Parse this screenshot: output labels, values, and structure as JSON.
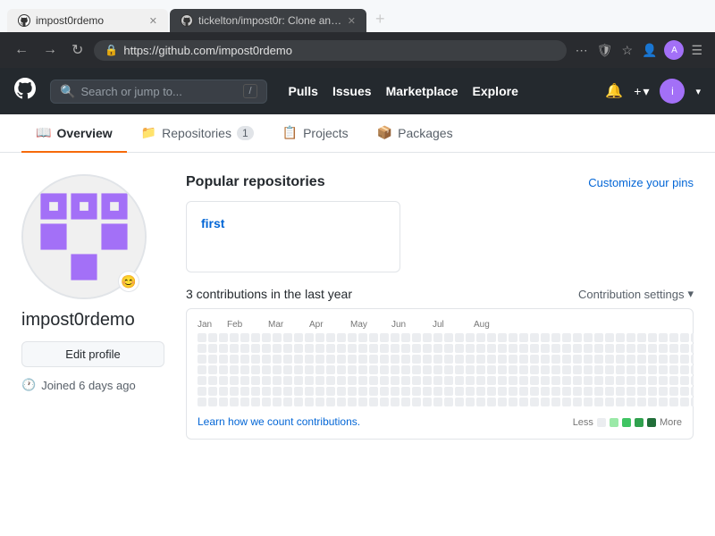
{
  "browser": {
    "tabs": [
      {
        "id": "tab1",
        "label": "impost0rdemo",
        "url": "https://github.com/impost0rdemo",
        "active": true,
        "favicon": "github"
      },
      {
        "id": "tab2",
        "label": "tickelton/impost0r: Clone anot…",
        "url": "",
        "active": false,
        "favicon": "github"
      }
    ],
    "address": "https://github.com/impost0rdemo",
    "new_tab_title": "+"
  },
  "nav": {
    "search_placeholder": "Search or jump to...",
    "slash_key": "/",
    "links": [
      "Pulls",
      "Issues",
      "Marketplace",
      "Explore"
    ],
    "logo_aria": "GitHub"
  },
  "profile_tabs": [
    {
      "id": "overview",
      "label": "Overview",
      "icon": "book",
      "active": true
    },
    {
      "id": "repositories",
      "label": "Repositories",
      "icon": "repo",
      "count": "1",
      "active": false
    },
    {
      "id": "projects",
      "label": "Projects",
      "icon": "project",
      "active": false
    },
    {
      "id": "packages",
      "label": "Packages",
      "icon": "package",
      "active": false
    }
  ],
  "profile": {
    "username": "impost0rdemo",
    "edit_profile_label": "Edit profile",
    "joined_text": "Joined 6 days ago"
  },
  "popular": {
    "title": "Popular repositories",
    "customize_label": "Customize your pins",
    "repos": [
      {
        "name": "first"
      }
    ]
  },
  "contributions": {
    "title": "3 contributions in the last year",
    "settings_label": "Contribution settings",
    "learn_link": "Learn how we count contributions.",
    "legend_less": "Less",
    "legend_more": "More",
    "months": [
      "Jan",
      "Feb",
      "Mar",
      "Apr",
      "May",
      "Jun",
      "Jul",
      "Aug"
    ]
  }
}
